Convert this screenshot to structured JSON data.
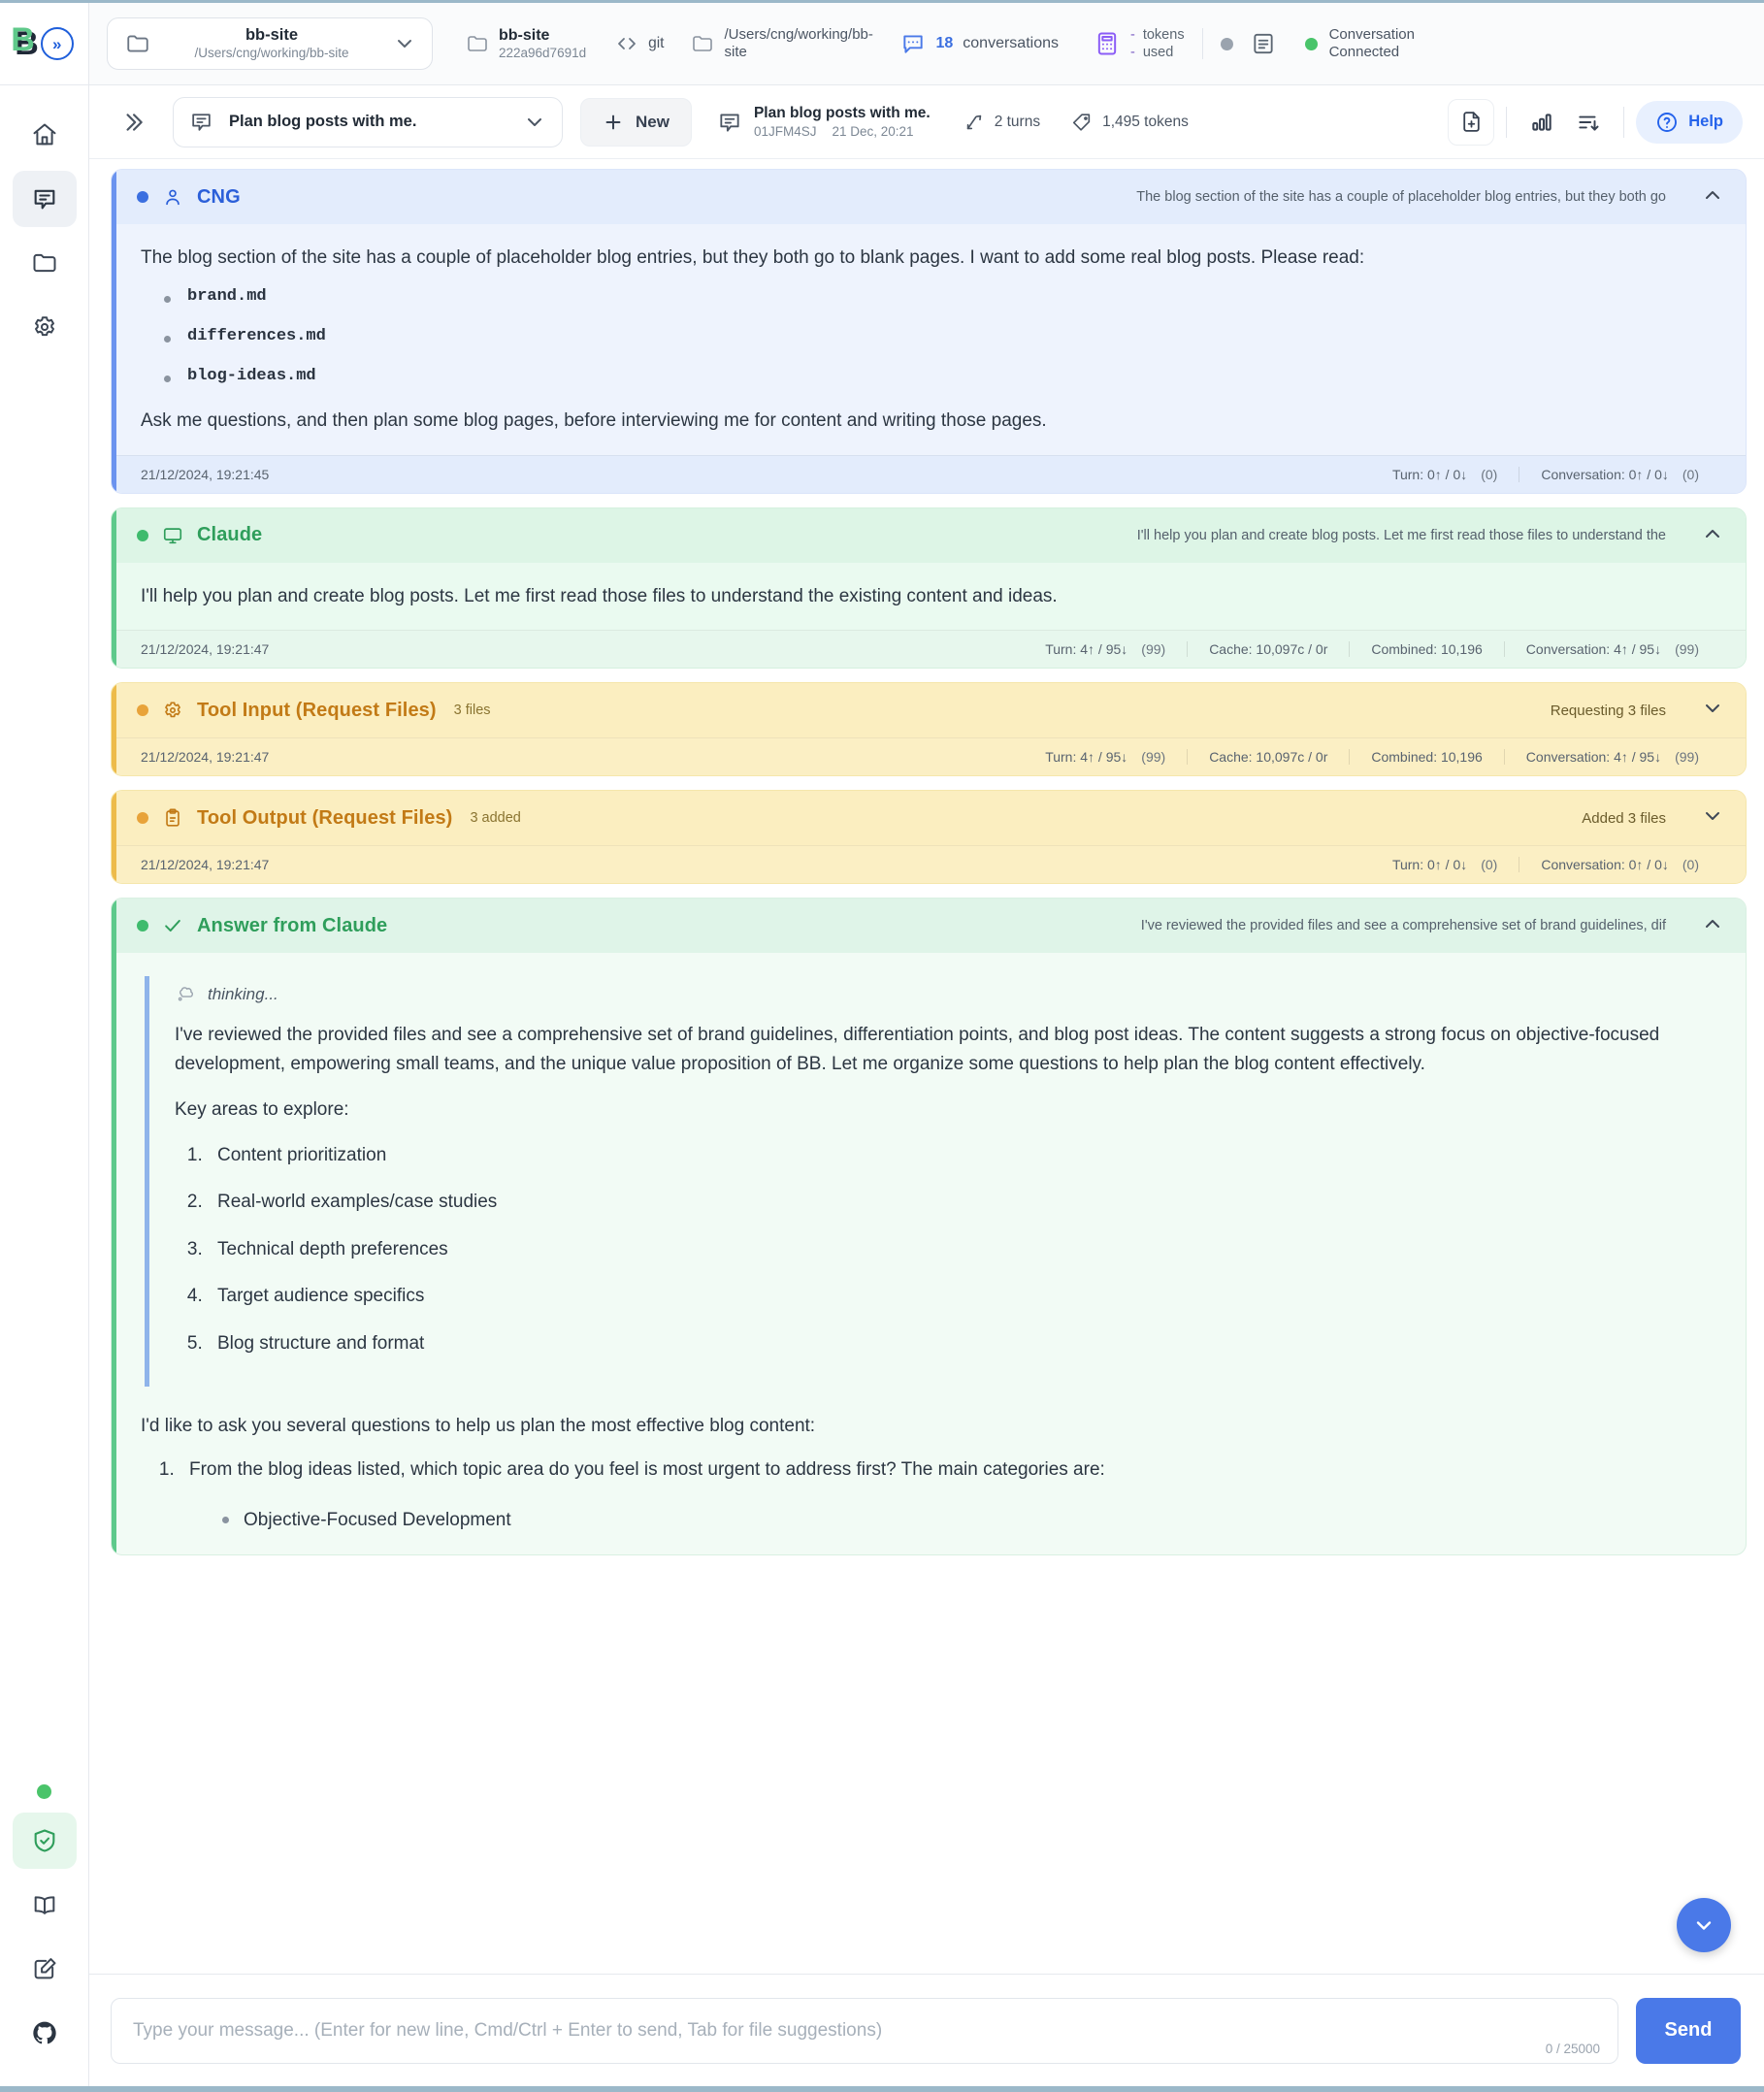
{
  "header": {
    "brand_letter": "B",
    "project_select": {
      "name": "bb-site",
      "path": "/Users/cng/working/bb-site"
    },
    "project_meta": {
      "name": "bb-site",
      "hash": "222a96d7691d",
      "vcs": "git",
      "path": "/Users/cng/working/bb-site"
    },
    "conversations": {
      "count": "18",
      "label": "conversations"
    },
    "tokens": {
      "line1_dash": "-",
      "line1": "tokens",
      "line2_dash": "-",
      "line2": "used"
    },
    "status": {
      "line1": "Conversation",
      "line2": "Connected"
    }
  },
  "toolbar": {
    "conversation_select": "Plan blog posts with me.",
    "new_label": "New",
    "current": {
      "title": "Plan blog posts with me.",
      "id": "01JFM4SJ",
      "date": "21 Dec, 20:21"
    },
    "turns": "2 turns",
    "tokens": "1,495 tokens",
    "help_label": "Help"
  },
  "rail": {
    "items": [
      {
        "name": "home",
        "icon": "home-icon"
      },
      {
        "name": "conversations",
        "icon": "chat-icon",
        "active": true
      },
      {
        "name": "files",
        "icon": "folder-icon"
      },
      {
        "name": "settings",
        "icon": "gear-icon"
      }
    ],
    "bottom_items": [
      {
        "name": "status",
        "icon": "status-dot-icon"
      },
      {
        "name": "security",
        "icon": "shield-check-icon",
        "active": true
      },
      {
        "name": "docs",
        "icon": "book-icon"
      },
      {
        "name": "edit",
        "icon": "edit-icon"
      },
      {
        "name": "github",
        "icon": "github-icon"
      }
    ]
  },
  "messages": [
    {
      "role": "CNG",
      "title": "CNG",
      "preview": "The blog section of the site has a couple of placeholder blog entries, but they both go",
      "paragraph_1": "The blog section of the site has a couple of placeholder blog entries, but they both go to blank pages. I want to add some real blog posts. Please read:",
      "files": [
        "brand.md",
        "differences.md",
        "blog-ideas.md"
      ],
      "paragraph_2": "Ask me questions, and then plan some blog pages, before interviewing me for content and writing those pages.",
      "timestamp": "21/12/2024, 19:21:45",
      "stats": [
        {
          "label": "Turn: 0↑ / 0↓",
          "paren": "(0)"
        },
        {
          "label": "Conversation: 0↑ / 0↓",
          "paren": "(0)"
        }
      ]
    },
    {
      "role": "Claude",
      "title": "Claude",
      "preview": "I'll help you plan and create blog posts. Let me first read those files to understand the",
      "body": "I'll help you plan and create blog posts. Let me first read those files to understand the existing content and ideas.",
      "timestamp": "21/12/2024, 19:21:47",
      "stats": [
        {
          "label": "Turn: 4↑ / 95↓",
          "paren": "(99)"
        },
        {
          "label": "Cache: 10,097c / 0r",
          "paren": ""
        },
        {
          "label": "Combined: 10,196",
          "paren": ""
        },
        {
          "label": "Conversation: 4↑ / 95↓",
          "paren": "(99)"
        }
      ]
    },
    {
      "role": "tool-input",
      "title": "Tool Input (Request Files)",
      "badge": "3 files",
      "status": "Requesting 3 files",
      "timestamp": "21/12/2024, 19:21:47",
      "stats": [
        {
          "label": "Turn: 4↑ / 95↓",
          "paren": "(99)"
        },
        {
          "label": "Cache: 10,097c / 0r",
          "paren": ""
        },
        {
          "label": "Combined: 10,196",
          "paren": ""
        },
        {
          "label": "Conversation: 4↑ / 95↓",
          "paren": "(99)"
        }
      ]
    },
    {
      "role": "tool-output",
      "title": "Tool Output (Request Files)",
      "badge": "3 added",
      "status": "Added 3 files",
      "timestamp": "21/12/2024, 19:21:47",
      "stats": [
        {
          "label": "Turn: 0↑ / 0↓",
          "paren": "(0)"
        },
        {
          "label": "Conversation: 0↑ / 0↓",
          "paren": "(0)"
        }
      ]
    },
    {
      "role": "answer",
      "title": "Answer from Claude",
      "preview": "I've reviewed the provided files and see a comprehensive set of brand guidelines, dif",
      "thinking_label": "thinking...",
      "thinking_paragraph": "I've reviewed the provided files and see a comprehensive set of brand guidelines, differentiation points, and blog post ideas. The content suggests a strong focus on objective-focused development, empowering small teams, and the unique value proposition of BB. Let me organize some questions to help plan the blog content effectively.",
      "thinking_subheading": "Key areas to explore:",
      "thinking_list": [
        "Content prioritization",
        "Real-world examples/case studies",
        "Technical depth preferences",
        "Target audience specifics",
        "Blog structure and format"
      ],
      "answer_intro": "I'd like to ask you several questions to help us plan the most effective blog content:",
      "question_1": "From the blog ideas listed, which topic area do you feel is most urgent to address first? The main categories are:",
      "question_1_options": [
        "Objective-Focused Development"
      ]
    }
  ],
  "composer": {
    "placeholder": "Type your message... (Enter for new line, Cmd/Ctrl + Enter to send, Tab for file suggestions)",
    "value": "",
    "counter": "0 / 25000",
    "send_label": "Send"
  },
  "colors": {
    "accent_blue": "#4a79e8",
    "user_blue": "#2b5fd9",
    "claude_green": "#2f9e5b",
    "tool_amber": "#c27a16"
  }
}
